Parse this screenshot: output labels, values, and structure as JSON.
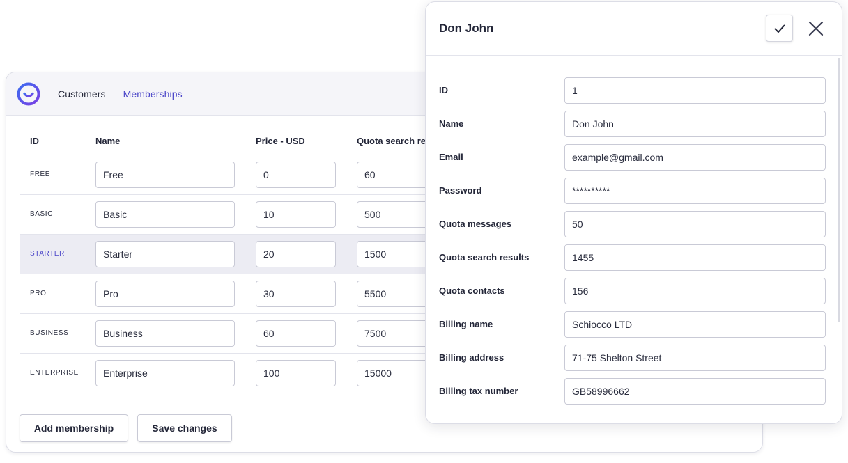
{
  "nav": {
    "logo_icon": "brand-logo-icon",
    "items": [
      {
        "label": "Customers",
        "active": false
      },
      {
        "label": "Memberships",
        "active": true
      }
    ]
  },
  "memberships": {
    "columns": [
      "ID",
      "Name",
      "Price - USD",
      "Quota search re"
    ],
    "rows": [
      {
        "id": "FREE",
        "name": "Free",
        "price": "0",
        "quota": "60",
        "selected": false
      },
      {
        "id": "BASIC",
        "name": "Basic",
        "price": "10",
        "quota": "500",
        "selected": false
      },
      {
        "id": "STARTER",
        "name": "Starter",
        "price": "20",
        "quota": "1500",
        "selected": true
      },
      {
        "id": "PRO",
        "name": "Pro",
        "price": "30",
        "quota": "5500",
        "selected": false
      },
      {
        "id": "BUSINESS",
        "name": "Business",
        "price": "60",
        "quota": "7500",
        "selected": false
      },
      {
        "id": "ENTERPRISE",
        "name": "Enterprise",
        "price": "100",
        "quota": "15000",
        "selected": false
      }
    ],
    "add_button": "Add membership",
    "save_button": "Save changes"
  },
  "dialog": {
    "title": "Don John",
    "confirm_icon": "check-icon",
    "close_icon": "close-icon",
    "fields": [
      {
        "label": "ID",
        "value": "1"
      },
      {
        "label": "Name",
        "value": "Don John"
      },
      {
        "label": "Email",
        "value": "example@gmail.com"
      },
      {
        "label": "Password",
        "value": "**********"
      },
      {
        "label": "Quota messages",
        "value": "50"
      },
      {
        "label": "Quota search results",
        "value": "1455"
      },
      {
        "label": "Quota contacts",
        "value": "156"
      },
      {
        "label": "Billing name",
        "value": "Schiocco LTD"
      },
      {
        "label": "Billing address",
        "value": "71-75 Shelton Street"
      },
      {
        "label": "Billing tax number",
        "value": "GB58996662"
      }
    ]
  },
  "colors": {
    "accent": "#4a45c8",
    "logo_gradient_start": "#3b6bf0",
    "logo_gradient_end": "#7b3fe4",
    "text": "#232638",
    "border": "#c9cad6",
    "selected_row": "#ececf3"
  }
}
